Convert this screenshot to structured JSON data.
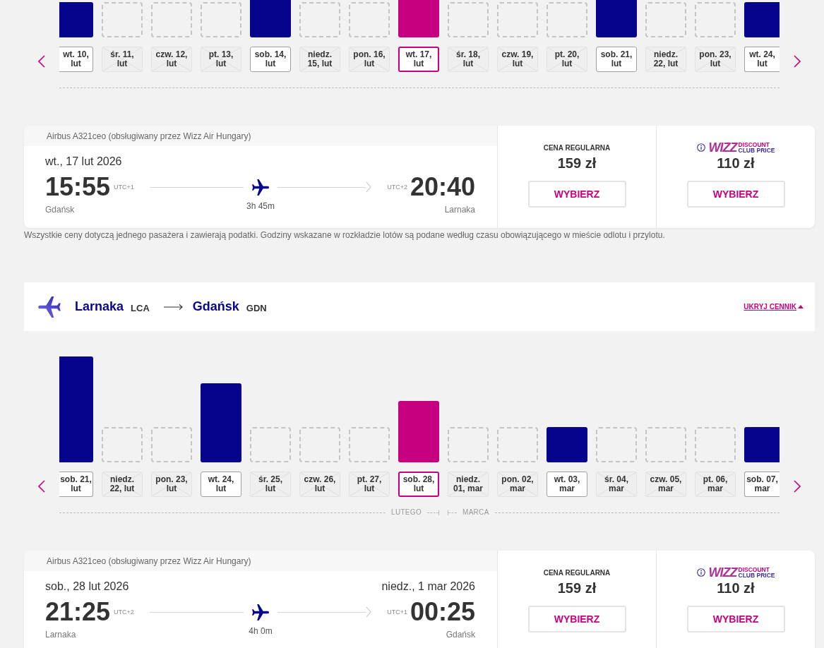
{
  "outbound_calendar": {
    "months": [
      {
        "days": [
          {
            "label": "wt. 10, lut",
            "available": true,
            "selected": false
          },
          {
            "label": "śr. 11, lut",
            "available": false,
            "selected": false
          },
          {
            "label": "czw. 12, lut",
            "available": false,
            "selected": false
          },
          {
            "label": "pt. 13, lut",
            "available": false,
            "selected": false
          },
          {
            "label": "sob. 14, lut",
            "available": true,
            "selected": false
          },
          {
            "label": "niedz. 15, lut",
            "available": false,
            "selected": false
          },
          {
            "label": "pon. 16, lut",
            "available": false,
            "selected": false
          },
          {
            "label": "wt. 17, lut",
            "available": true,
            "selected": true
          },
          {
            "label": "śr. 18, lut",
            "available": false,
            "selected": false
          },
          {
            "label": "czw. 19, lut",
            "available": false,
            "selected": false
          },
          {
            "label": "pt. 20, lut",
            "available": false,
            "selected": false
          },
          {
            "label": "sob. 21, lut",
            "available": true,
            "selected": false
          },
          {
            "label": "niedz. 22, lut",
            "available": false,
            "selected": false
          },
          {
            "label": "pon. 23, lut",
            "available": false,
            "selected": false
          },
          {
            "label": "wt. 24, lut",
            "available": true,
            "selected": false
          }
        ]
      }
    ]
  },
  "outbound_flight": {
    "aircraft": "Airbus A321ceo (obsługiwany przez Wizz Air Hungary)",
    "departure_date": "wt., 17 lut 2026",
    "departure_time": "15:55",
    "departure_utc": "UTC+1",
    "origin": "Gdańsk",
    "duration": "3h 45m",
    "arrival_utc": "UTC+2",
    "arrival_time": "20:40",
    "destination": "Larnaka",
    "fares": [
      {
        "kind": "regular",
        "title": "CENA REGULARNA",
        "price": "159 zł",
        "button": "WYBIERZ"
      },
      {
        "kind": "club",
        "logo_wordmark": "WIZZ",
        "logo_lines": [
          "DISCOUNT",
          "CLUB PRICE"
        ],
        "price": "110 zł",
        "button": "WYBIERZ"
      }
    ]
  },
  "footnote": "Wszystkie ceny dotyczą jednego pasażera i zawierają podatki. Godziny wskazane w rozkładzie lotów są podane według czasu obowiązującego w mieście odlotu i przylotu.",
  "return_route": {
    "origin_city": "Larnaka",
    "origin_code": "LCA",
    "destination_city": "Gdańsk",
    "destination_code": "GDN",
    "toggle_link": "UKRYJ CENNIK"
  },
  "return_calendar": {
    "months": [
      {
        "label": "LUTEGO",
        "days": [
          {
            "label": "sob. 21, lut",
            "available": true,
            "selected": false
          },
          {
            "label": "niedz. 22, lut",
            "available": false,
            "selected": false
          },
          {
            "label": "pon. 23, lut",
            "available": false,
            "selected": false
          },
          {
            "label": "wt. 24, lut",
            "available": true,
            "selected": false
          },
          {
            "label": "śr. 25, lut",
            "available": false,
            "selected": false
          },
          {
            "label": "czw. 26, lut",
            "available": false,
            "selected": false
          },
          {
            "label": "pt. 27, lut",
            "available": false,
            "selected": false
          },
          {
            "label": "sob. 28, lut",
            "available": true,
            "selected": true
          }
        ]
      },
      {
        "label": "MARCA",
        "days": [
          {
            "label": "niedz. 01, mar",
            "available": false,
            "selected": false
          },
          {
            "label": "pon. 02, mar",
            "available": false,
            "selected": false
          },
          {
            "label": "wt. 03, mar",
            "available": true,
            "selected": false
          },
          {
            "label": "śr. 04, mar",
            "available": false,
            "selected": false
          },
          {
            "label": "czw. 05, mar",
            "available": false,
            "selected": false
          },
          {
            "label": "pt. 06, mar",
            "available": false,
            "selected": false
          },
          {
            "label": "sob. 07, mar",
            "available": true,
            "selected": false
          }
        ]
      }
    ]
  },
  "return_flight": {
    "aircraft": "Airbus A321ceo (obsługiwany przez Wizz Air Hungary)",
    "departure_date": "sob., 28 lut 2026",
    "arrival_date": "niedz., 1 mar 2026",
    "departure_time": "21:25",
    "departure_utc": "UTC+2",
    "origin": "Larnaka",
    "duration": "4h 0m",
    "arrival_utc": "UTC+1",
    "arrival_time": "00:25",
    "destination": "Gdańsk",
    "fares": [
      {
        "kind": "regular",
        "title": "CENA REGULARNA",
        "price": "159 zł",
        "button": "WYBIERZ"
      },
      {
        "kind": "club",
        "logo_wordmark": "WIZZ",
        "logo_lines": [
          "DISCOUNT",
          "CLUB PRICE"
        ],
        "price": "110 zł",
        "button": "WYBIERZ"
      }
    ]
  }
}
